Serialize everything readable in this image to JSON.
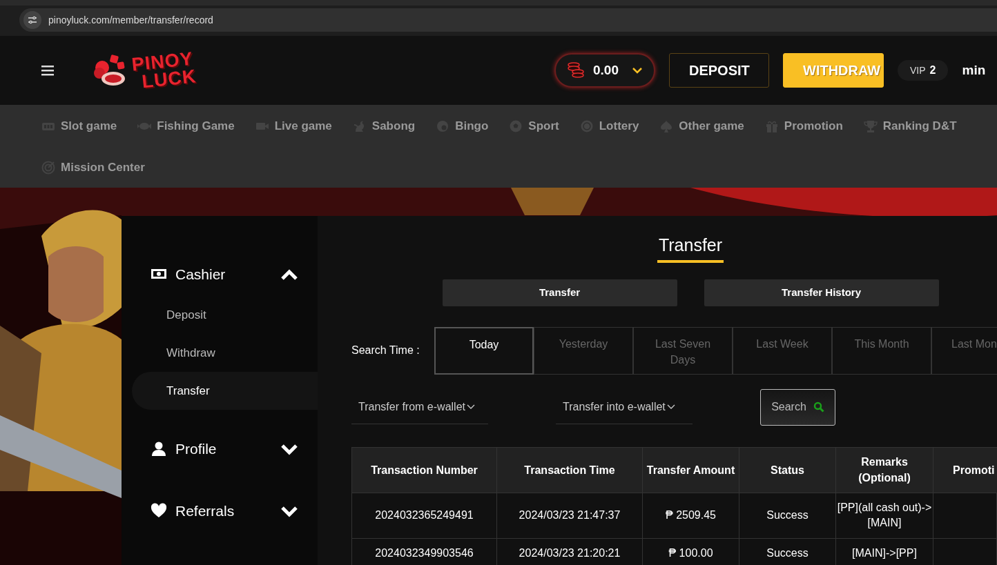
{
  "browser": {
    "url": "pinoyluck.com/member/transfer/record"
  },
  "header": {
    "logo": {
      "line_1": "PINOY",
      "line_2": "LUCK"
    },
    "balance": "0.00",
    "buttons": [
      {
        "label": "DEPOSIT",
        "kind": "outline"
      },
      {
        "label": "WITHDRAW",
        "kind": "primary"
      }
    ],
    "vip": {
      "label": "VIP",
      "level_text": "2"
    },
    "username": "min"
  },
  "nav": {
    "items": [
      {
        "label": "Slot game"
      },
      {
        "label": "Fishing Game"
      },
      {
        "label": "Live game"
      },
      {
        "label": "Sabong"
      },
      {
        "label": "Bingo"
      },
      {
        "label": "Sport"
      },
      {
        "label": "Lottery"
      },
      {
        "label": "Other game"
      },
      {
        "label": "Promotion"
      },
      {
        "label": "Ranking D&T"
      },
      {
        "label": "Mission Center"
      }
    ]
  },
  "sidebar": {
    "sections": [
      {
        "label": "Cashier",
        "expanded": true,
        "items": [
          {
            "label": "Deposit",
            "selected": false
          },
          {
            "label": "Withdraw",
            "selected": false
          },
          {
            "label": "Transfer",
            "selected": true
          }
        ]
      },
      {
        "label": "Profile",
        "expanded": false
      },
      {
        "label": "Referrals",
        "expanded": false
      }
    ]
  },
  "page": {
    "title": "Transfer",
    "tabs": [
      {
        "label": "Transfer"
      },
      {
        "label": "Transfer History"
      }
    ],
    "search_time": {
      "label": "Search Time :",
      "options": [
        {
          "label": "Today",
          "selected": true
        },
        {
          "label": "Yesterday",
          "selected": false
        },
        {
          "label": "Last Seven Days",
          "selected": false
        },
        {
          "label": "Last Week",
          "selected": false
        },
        {
          "label": "This Month",
          "selected": false
        },
        {
          "label": "Last Mon",
          "selected": false
        }
      ]
    },
    "filters": [
      {
        "value": "Transfer from e-wallet"
      },
      {
        "value": "Transfer into e-wallet"
      }
    ],
    "search_button": "Search"
  },
  "table": {
    "columns": [
      "Transaction Number",
      "Transaction Time",
      "Transfer Amount",
      "Status",
      "Remarks (Optional)",
      "Promoti"
    ],
    "rows": [
      [
        "2024032365249491",
        "2024/03/23 21:47:37",
        "₱ 2509.45",
        "Success",
        "[PP](all cash out)->[MAIN]",
        ""
      ],
      [
        "2024032349903546",
        "2024/03/23 21:20:21",
        "₱ 100.00",
        "Success",
        "[MAIN]->[PP]",
        ""
      ]
    ]
  }
}
